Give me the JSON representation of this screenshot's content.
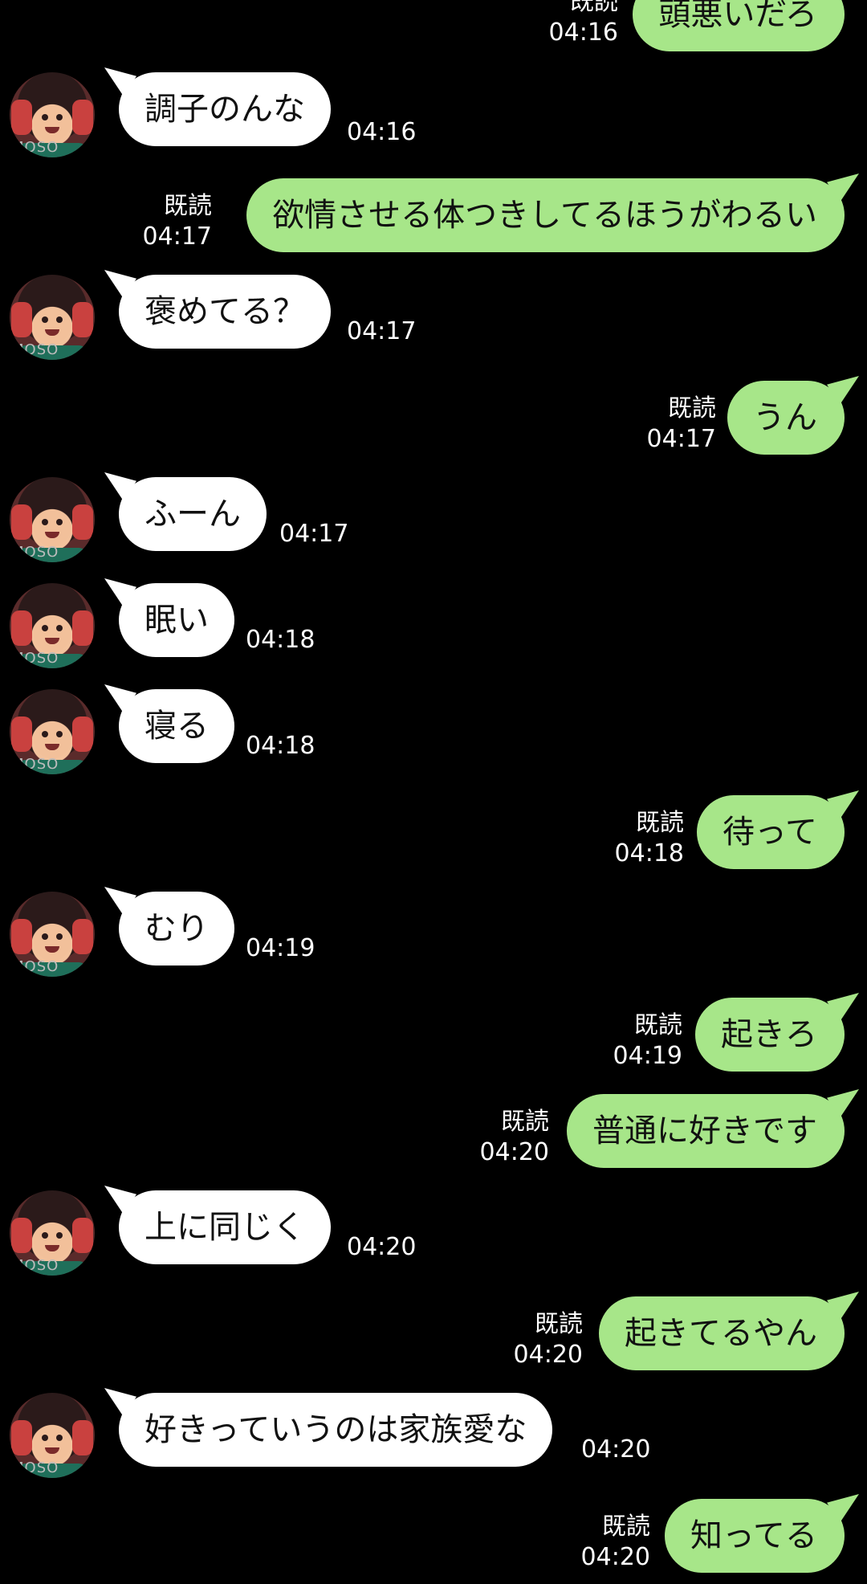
{
  "read_label": "既読",
  "watermark": "MOSO",
  "messages": [
    {
      "sender": "me",
      "text": "頭悪いだろ",
      "time": "04:16"
    },
    {
      "sender": "them",
      "text": "調子のんな",
      "time": "04:16"
    },
    {
      "sender": "me",
      "text": "欲情させる体つきしてるほうがわるい",
      "time": "04:17"
    },
    {
      "sender": "them",
      "text": "褒めてる？",
      "time": "04:17"
    },
    {
      "sender": "me",
      "text": "うん",
      "time": "04:17"
    },
    {
      "sender": "them",
      "text": "ふーん",
      "time": "04:17"
    },
    {
      "sender": "them",
      "text": "眠い",
      "time": "04:18"
    },
    {
      "sender": "them",
      "text": "寝る",
      "time": "04:18"
    },
    {
      "sender": "me",
      "text": "待って",
      "time": "04:18"
    },
    {
      "sender": "them",
      "text": "むり",
      "time": "04:19"
    },
    {
      "sender": "me",
      "text": "起きろ",
      "time": "04:19"
    },
    {
      "sender": "me",
      "text": "普通に好きです",
      "time": "04:20"
    },
    {
      "sender": "them",
      "text": "上に同じく",
      "time": "04:20"
    },
    {
      "sender": "me",
      "text": "起きてるやん",
      "time": "04:20"
    },
    {
      "sender": "them",
      "text": "好きっていうのは家族愛な",
      "time": "04:20"
    },
    {
      "sender": "me",
      "text": "知ってる",
      "time": "04:20"
    }
  ]
}
